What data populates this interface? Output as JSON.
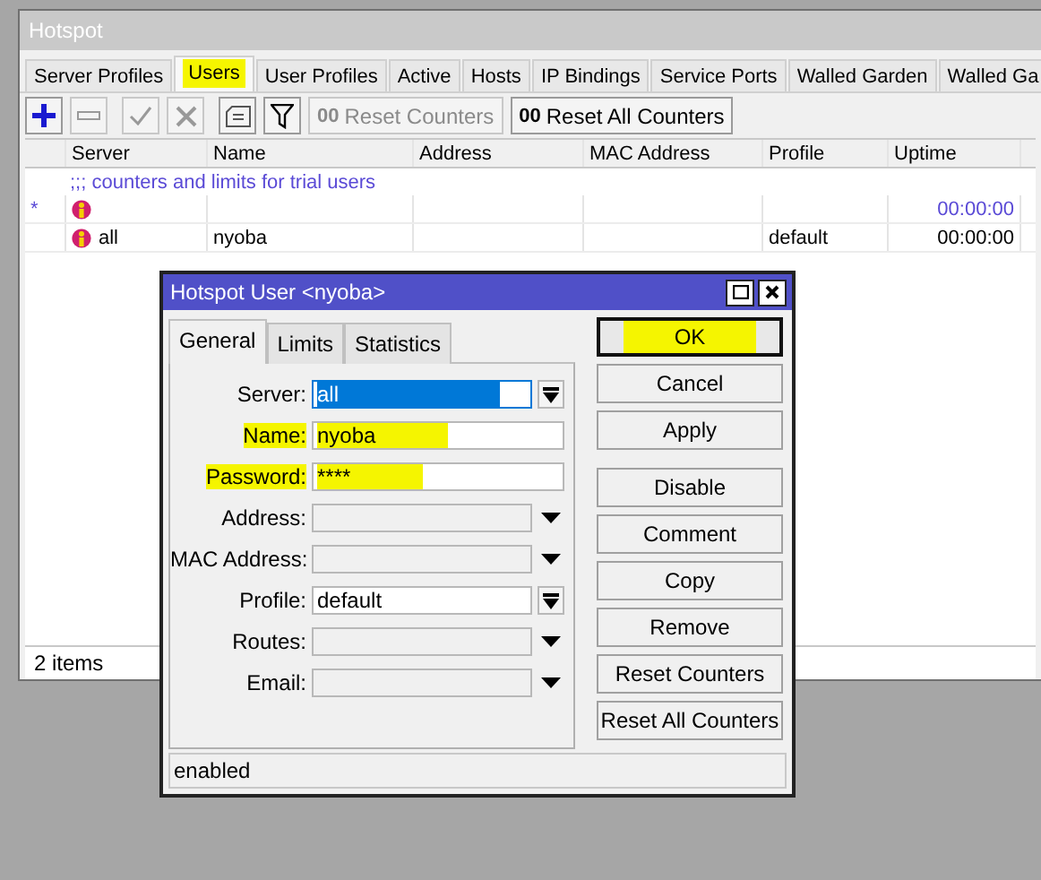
{
  "window": {
    "title": "Hotspot"
  },
  "tabs": [
    {
      "label": "Server Profiles",
      "selected": false,
      "highlighted": false
    },
    {
      "label": "Users",
      "selected": true,
      "highlighted": true
    },
    {
      "label": "User Profiles",
      "selected": false,
      "highlighted": false
    },
    {
      "label": "Active",
      "selected": false,
      "highlighted": false
    },
    {
      "label": "Hosts",
      "selected": false,
      "highlighted": false
    },
    {
      "label": "IP Bindings",
      "selected": false,
      "highlighted": false
    },
    {
      "label": "Service Ports",
      "selected": false,
      "highlighted": false
    },
    {
      "label": "Walled Garden",
      "selected": false,
      "highlighted": false
    },
    {
      "label": "Walled Ga",
      "selected": false,
      "highlighted": false
    }
  ],
  "toolbar": [
    {
      "kind": "add",
      "disabled": false
    },
    {
      "kind": "remove",
      "disabled": true
    },
    {
      "kind": "enable",
      "disabled": true
    },
    {
      "kind": "disable",
      "disabled": true
    },
    {
      "kind": "comment",
      "disabled": false
    },
    {
      "kind": "filter",
      "disabled": false
    },
    {
      "kind": "text",
      "glyph": "00",
      "label": "Reset Counters",
      "disabled": true
    },
    {
      "kind": "text",
      "glyph": "00",
      "label": "Reset All Counters",
      "disabled": false
    }
  ],
  "table": {
    "columns": [
      "Server",
      "Name",
      "Address",
      "MAC Address",
      "Profile",
      "Uptime"
    ],
    "comment": ";;; counters and limits for trial users",
    "rows": [
      {
        "marker": "*",
        "color": "#5a4ad6",
        "cells": [
          "",
          "",
          "",
          "",
          "",
          "00:00:00"
        ]
      },
      {
        "color": "#000000",
        "cells": [
          "all",
          "nyoba",
          "",
          "",
          "default",
          "00:00:00"
        ]
      }
    ]
  },
  "status_bar": "2 items",
  "dialog": {
    "title": "Hotspot User <nyoba>",
    "tabs": [
      {
        "label": "General",
        "selected": true
      },
      {
        "label": "Limits",
        "selected": false
      },
      {
        "label": "Statistics",
        "selected": false
      }
    ],
    "fields": [
      {
        "label": "Server:",
        "value": "all",
        "kind": "select",
        "focused": true,
        "highlighted": false
      },
      {
        "label": "Name:",
        "value": "nyoba",
        "kind": "text",
        "focused": false,
        "highlighted": true
      },
      {
        "label": "Password:",
        "value": "****",
        "kind": "text",
        "focused": false,
        "highlighted": true
      },
      {
        "label": "Address:",
        "kind": "combo",
        "highlighted": false
      },
      {
        "label": "MAC Address:",
        "kind": "combo",
        "highlighted": false
      },
      {
        "label": "Profile:",
        "value": "default",
        "kind": "select",
        "focused": false,
        "highlighted": false
      },
      {
        "label": "Routes:",
        "kind": "combo",
        "highlighted": false
      },
      {
        "label": "Email:",
        "kind": "combo",
        "highlighted": false
      }
    ],
    "buttons": [
      {
        "label": "OK",
        "default": true,
        "highlighted": true
      },
      {
        "label": "Cancel",
        "default": false,
        "highlighted": false
      },
      {
        "label": "Apply",
        "default": false,
        "highlighted": false
      },
      {
        "label": "Disable",
        "default": false,
        "highlighted": false
      },
      {
        "label": "Comment",
        "default": false,
        "highlighted": false
      },
      {
        "label": "Copy",
        "default": false,
        "highlighted": false
      },
      {
        "label": "Remove",
        "default": false,
        "highlighted": false
      },
      {
        "label": "Reset Counters",
        "default": false,
        "highlighted": false
      },
      {
        "label": "Reset All Counters",
        "default": false,
        "highlighted": false
      }
    ],
    "status": "enabled"
  }
}
